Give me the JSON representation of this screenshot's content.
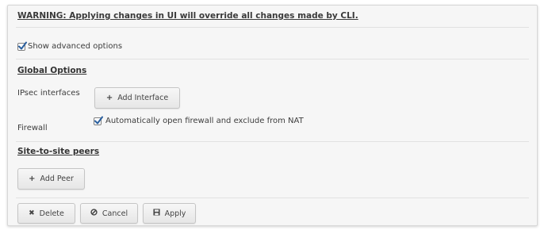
{
  "warning": "WARNING: Applying changes in UI will override all changes made by CLI.",
  "advanced": {
    "label": "Show advanced options",
    "checked": true
  },
  "global": {
    "title": "Global Options",
    "ipsec_label": "IPsec interfaces",
    "add_interface_label": "Add Interface",
    "firewall_label": "Firewall",
    "firewall_checkbox_label": "Automatically open firewall and exclude from NAT",
    "firewall_checked": true
  },
  "peers": {
    "title": "Site-to-site peers",
    "add_peer_label": "Add Peer"
  },
  "actions": {
    "delete_label": "Delete",
    "cancel_label": "Cancel",
    "apply_label": "Apply"
  },
  "icons": {
    "plus": "plus-icon",
    "times": "times-icon",
    "cancel": "ban-icon",
    "save": "save-icon",
    "check": "checkmark-icon"
  },
  "colors": {
    "panel_bg": "#f6f6f6",
    "check_blue": "#2a5f9e",
    "text": "#333333"
  }
}
